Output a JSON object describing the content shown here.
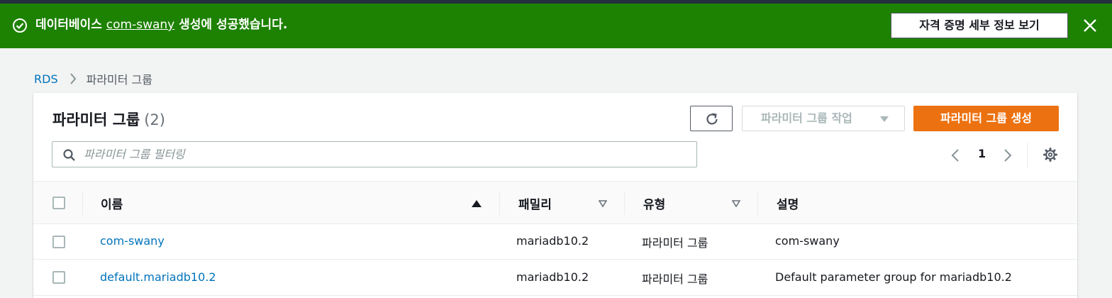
{
  "flash": {
    "message_prefix": "데이터베이스",
    "message_link": "com-swany",
    "message_suffix": "생성에 성공했습니다.",
    "details_button": "자격 증명 세부 정보 보기",
    "color": "#1d8102"
  },
  "breadcrumb": {
    "root": "RDS",
    "current": "파라미터 그룹"
  },
  "panel": {
    "title": "파라미터 그룹",
    "count": "(2)",
    "actions_button": "파라미터 그룹 작업",
    "create_button": "파라미터 그룹 생성",
    "create_color": "#ec7211",
    "filter_placeholder": "파라미터 그룹 필터링",
    "page_number": "1"
  },
  "table": {
    "columns": [
      "이름",
      "패밀리",
      "유형",
      "설명"
    ],
    "sort": {
      "column": "이름",
      "direction": "ascending"
    },
    "rows": [
      {
        "name": "com-swany",
        "family": "mariadb10.2",
        "type": "파라미터 그룹",
        "description": "com-swany"
      },
      {
        "name": "default.mariadb10.2",
        "family": "mariadb10.2",
        "type": "파라미터 그룹",
        "description": "Default parameter group for mariadb10.2"
      }
    ]
  },
  "icons": {
    "flash_icon": "check-circle-icon",
    "close": "close-icon",
    "breadcrumb_separator": "chevron-right-icon",
    "refresh": "refresh-icon",
    "search": "search-icon",
    "prev_page": "chevron-left-icon",
    "next_page": "chevron-right-icon",
    "settings": "gear-icon"
  }
}
